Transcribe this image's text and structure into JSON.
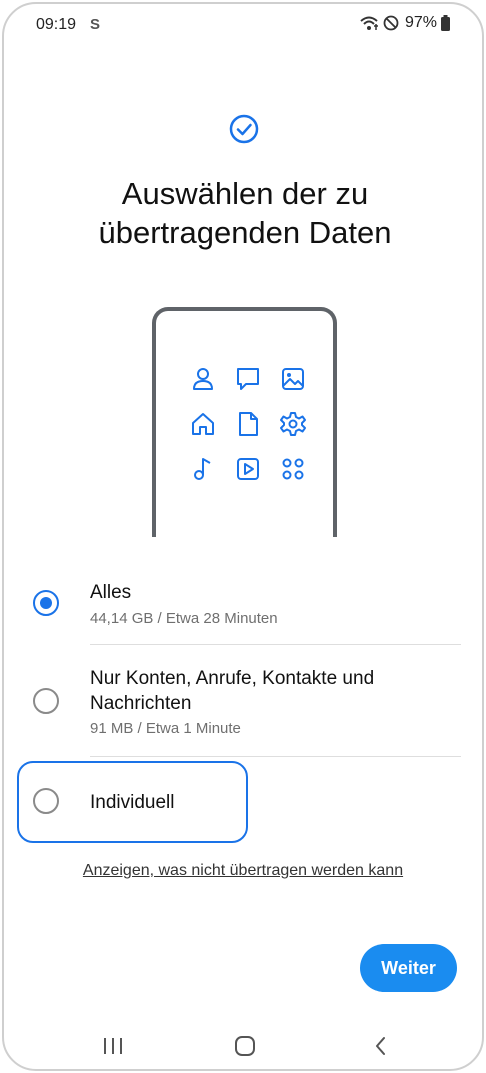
{
  "status_bar": {
    "time": "09:19",
    "indicator": "S",
    "battery": "97%",
    "icons": [
      "wifi-icon",
      "do-not-disturb-icon",
      "battery-icon"
    ]
  },
  "header": {
    "title": "Auswählen der zu übertragenden Daten",
    "icon": "check-circle-icon"
  },
  "illustration": {
    "icons": [
      "contact-icon",
      "message-icon",
      "image-icon",
      "home-icon",
      "document-icon",
      "settings-icon",
      "music-icon",
      "video-icon",
      "apps-icon"
    ]
  },
  "options": [
    {
      "label": "Alles",
      "sub": "44,14 GB / Etwa 28 Minuten",
      "selected": true
    },
    {
      "label": "Nur Konten, Anrufe, Kontakte und Nachrichten",
      "sub": "91 MB / Etwa 1 Minute",
      "selected": false
    },
    {
      "label": "Individuell",
      "sub": "",
      "selected": false
    }
  ],
  "link_text": "Anzeigen, was nicht übertragen werden kann",
  "next_button": "Weiter",
  "nav": [
    "recent-apps-icon",
    "home-icon",
    "back-icon"
  ],
  "colors": {
    "accent": "#1a73e8",
    "button": "#1a8cf0"
  }
}
